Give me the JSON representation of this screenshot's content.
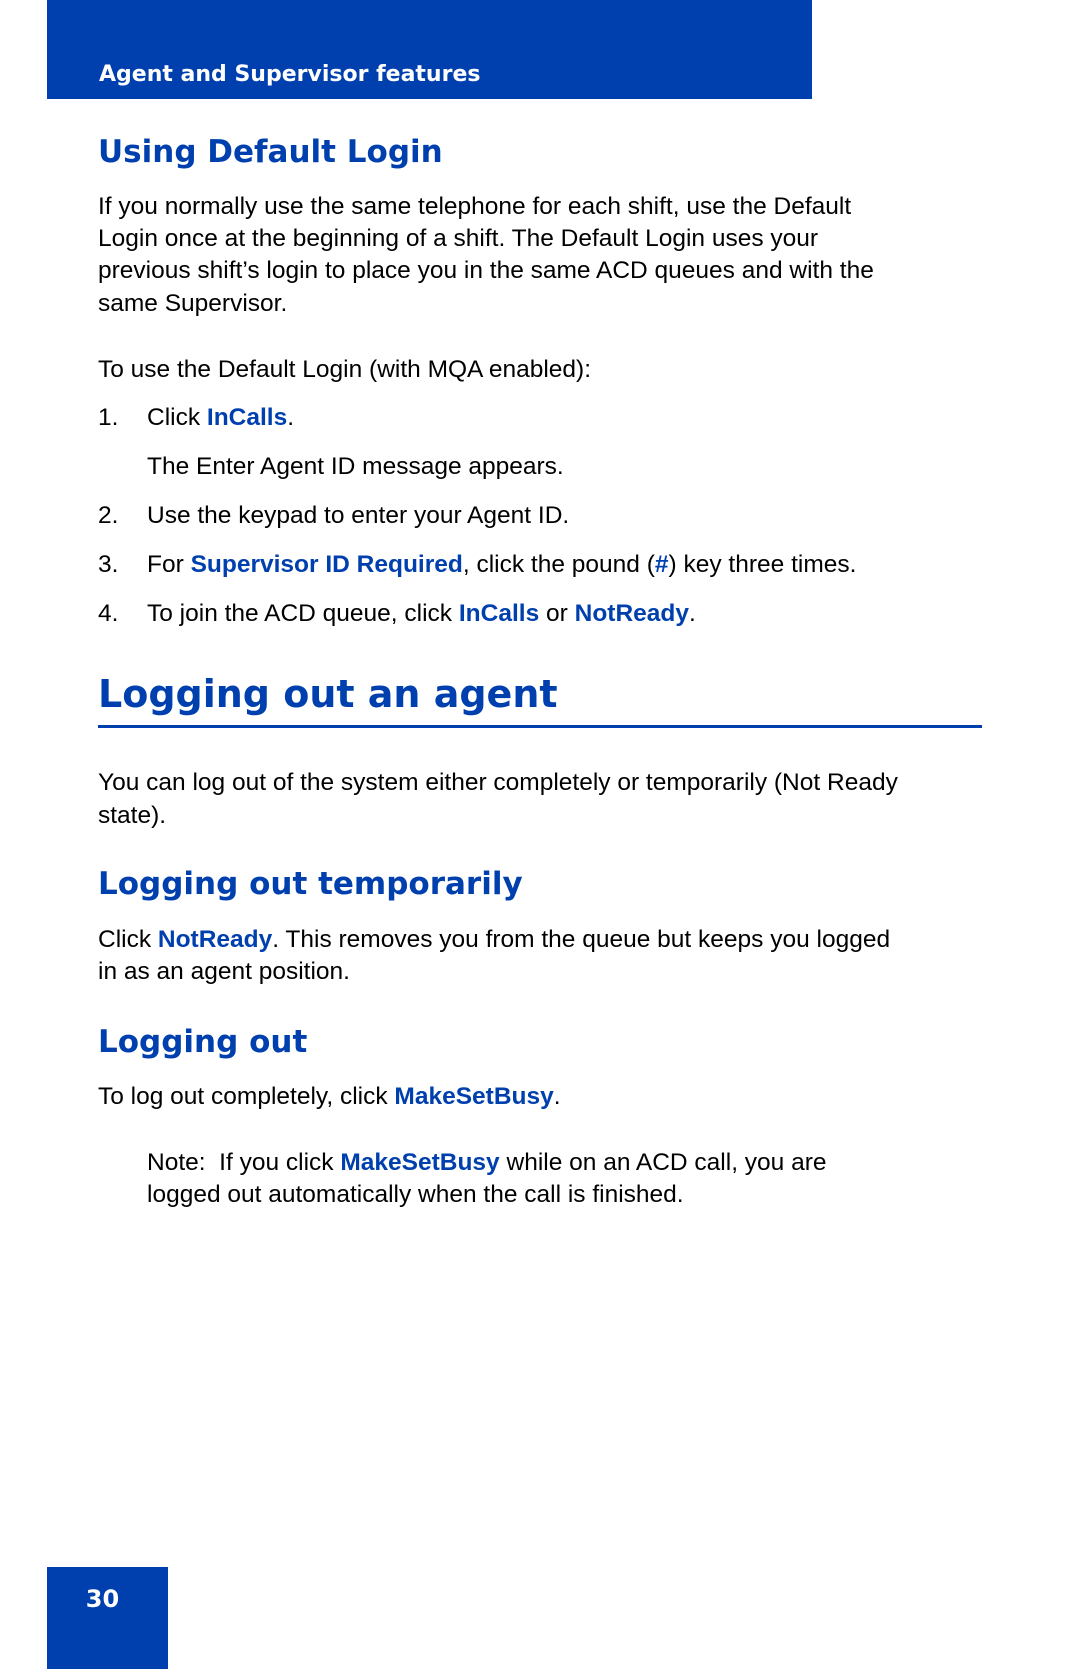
{
  "header": {
    "section_title": "Agent and Supervisor features"
  },
  "section_default_login": {
    "heading": "Using Default Login",
    "intro_lines": [
      "If you normally use the same telephone for each shift, use the Default",
      "Login once at the beginning of a shift. The Default Login uses your",
      "previous shift’s login to place you in the same ACD queues and with the",
      "same Supervisor."
    ],
    "procedure_lead": "To use the Default Login (with MQA enabled):",
    "steps": [
      {
        "num": "1.",
        "pre": "Click ",
        "key1": "InCalls",
        "post": "."
      },
      {
        "result": "The Enter Agent ID message appears."
      },
      {
        "num": "2.",
        "text": "Use the keypad to enter your Agent ID."
      },
      {
        "num": "3.",
        "pre": "For ",
        "key1": "Supervisor ID Required",
        "mid": ", click the pound (",
        "key2": "#",
        "post": ") key three times."
      },
      {
        "num": "4.",
        "pre": "To join the ACD queue, click ",
        "key1": "InCalls",
        "mid": " or ",
        "key2": "NotReady",
        "post": "."
      }
    ]
  },
  "section_logging_out_agent": {
    "heading": "Logging out an agent",
    "intro_lines": [
      "You can log out of the system either completely or temporarily (Not Ready",
      "state)."
    ]
  },
  "section_logging_out_temporarily": {
    "heading": "Logging out temporarily",
    "line1_pre": "Click ",
    "line1_key": "NotReady",
    "line1_post": ". This removes you from the queue but keeps you logged",
    "line2": "in as an agent position."
  },
  "section_logging_out": {
    "heading": "Logging out",
    "line_pre": "To log out completely, click ",
    "line_key": "MakeSetBusy",
    "line_post": ".",
    "note_pre": "Note:  If you click ",
    "note_key": "MakeSetBusy",
    "note_post": " while on an ACD call, you are",
    "note_line2": "logged out automatically when the call is finished."
  },
  "footer": {
    "page_number": "30"
  },
  "colors": {
    "brand_blue": "#0040ae",
    "text": "#000000",
    "background": "#ffffff"
  }
}
